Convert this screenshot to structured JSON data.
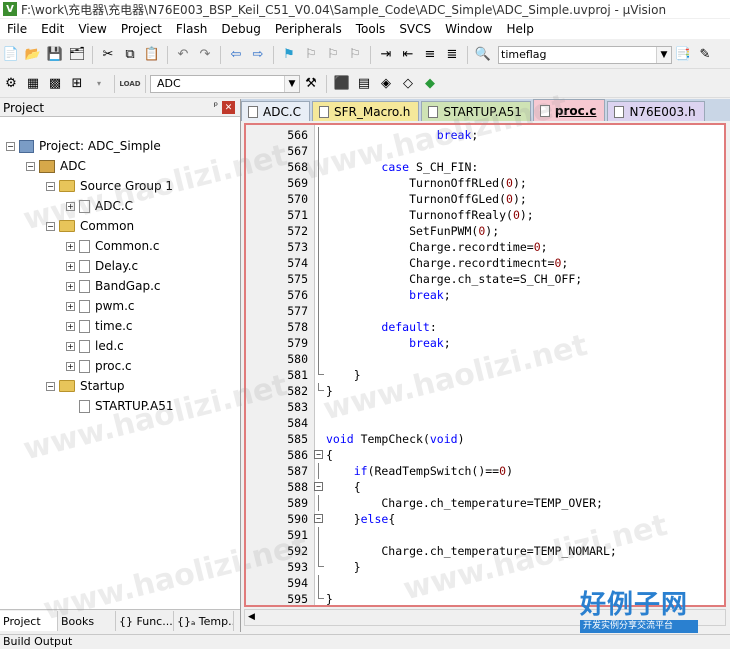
{
  "window": {
    "title": "F:\\work\\充电器\\充电器\\N76E003_BSP_Keil_C51_V0.04\\Sample_Code\\ADC_Simple\\ADC_Simple.uvproj - µVision",
    "logo_letter": "V"
  },
  "menu": [
    "File",
    "Edit",
    "View",
    "Project",
    "Flash",
    "Debug",
    "Peripherals",
    "Tools",
    "SVCS",
    "Window",
    "Help"
  ],
  "toolbar1": {
    "search_value": "timeflag"
  },
  "toolbar2": {
    "target_value": "ADC",
    "load_label": "LOAD"
  },
  "project_panel": {
    "title": "Project",
    "pin": "ᵖ",
    "close": "✕",
    "tree": [
      {
        "label": "Project: ADC_Simple",
        "level": 0,
        "icon": "project-icon",
        "expander": "−"
      },
      {
        "label": "ADC",
        "level": 1,
        "icon": "target-icon",
        "expander": "−"
      },
      {
        "label": "Source Group 1",
        "level": 2,
        "icon": "folder-icon",
        "expander": "−"
      },
      {
        "label": "ADC.C",
        "level": 3,
        "icon": "file-icon",
        "expander": "+"
      },
      {
        "label": "Common",
        "level": 2,
        "icon": "folder-icon",
        "expander": "−"
      },
      {
        "label": "Common.c",
        "level": 3,
        "icon": "file-icon",
        "expander": "+"
      },
      {
        "label": "Delay.c",
        "level": 3,
        "icon": "file-icon",
        "expander": "+"
      },
      {
        "label": "BandGap.c",
        "level": 3,
        "icon": "file-icon",
        "expander": "+"
      },
      {
        "label": "pwm.c",
        "level": 3,
        "icon": "file-icon",
        "expander": "+"
      },
      {
        "label": "time.c",
        "level": 3,
        "icon": "file-icon",
        "expander": "+"
      },
      {
        "label": "led.c",
        "level": 3,
        "icon": "file-icon",
        "expander": "+"
      },
      {
        "label": "proc.c",
        "level": 3,
        "icon": "file-icon",
        "expander": "+"
      },
      {
        "label": "Startup",
        "level": 2,
        "icon": "folder-icon",
        "expander": "−"
      },
      {
        "label": "STARTUP.A51",
        "level": 3,
        "icon": "file-icon",
        "expander": ""
      }
    ],
    "bottom_tabs": [
      "Project",
      "Books",
      "{} Func...",
      "{}ₐ Temp..."
    ]
  },
  "editor": {
    "tabs": [
      {
        "label": "ADC.C",
        "color": "#e8eef6",
        "active": false
      },
      {
        "label": "SFR_Macro.h",
        "color": "#f5e89a",
        "active": false
      },
      {
        "label": "STARTUP.A51",
        "color": "#cfe3b5",
        "active": false
      },
      {
        "label": "proc.c",
        "color": "#f6c9d2",
        "active": true
      },
      {
        "label": "N76E003.h",
        "color": "#dcd3f0",
        "active": false
      }
    ],
    "lines": [
      {
        "n": "566",
        "fold": "line",
        "code": [
          [
            "",
            "                "
          ],
          [
            "kw",
            "break"
          ],
          [
            "",
            ";"
          ]
        ]
      },
      {
        "n": "567",
        "fold": "line",
        "code": []
      },
      {
        "n": "568",
        "fold": "line",
        "code": [
          [
            "",
            "        "
          ],
          [
            "kw",
            "case"
          ],
          [
            "",
            " S_CH_FIN:"
          ]
        ]
      },
      {
        "n": "569",
        "fold": "line",
        "code": [
          [
            "",
            "            TurnonOffRLed("
          ],
          [
            "num",
            "0"
          ],
          [
            "",
            ");"
          ]
        ]
      },
      {
        "n": "570",
        "fold": "line",
        "code": [
          [
            "",
            "            TurnonOffGLed("
          ],
          [
            "num",
            "0"
          ],
          [
            "",
            ");"
          ]
        ]
      },
      {
        "n": "571",
        "fold": "line",
        "code": [
          [
            "",
            "            TurnonoffRealy("
          ],
          [
            "num",
            "0"
          ],
          [
            "",
            ");"
          ]
        ]
      },
      {
        "n": "572",
        "fold": "line",
        "code": [
          [
            "",
            "            SetFunPWM("
          ],
          [
            "num",
            "0"
          ],
          [
            "",
            ");"
          ]
        ]
      },
      {
        "n": "573",
        "fold": "line",
        "code": [
          [
            "",
            "            Charge.recordtime="
          ],
          [
            "num",
            "0"
          ],
          [
            "",
            ";"
          ]
        ]
      },
      {
        "n": "574",
        "fold": "line",
        "code": [
          [
            "",
            "            Charge.recordtimecnt="
          ],
          [
            "num",
            "0"
          ],
          [
            "",
            ";"
          ]
        ]
      },
      {
        "n": "575",
        "fold": "line",
        "code": [
          [
            "",
            "            Charge.ch_state=S_CH_OFF;"
          ]
        ]
      },
      {
        "n": "576",
        "fold": "line",
        "code": [
          [
            "",
            "            "
          ],
          [
            "kw",
            "break"
          ],
          [
            "",
            ";"
          ]
        ]
      },
      {
        "n": "577",
        "fold": "line",
        "code": []
      },
      {
        "n": "578",
        "fold": "line",
        "code": [
          [
            "",
            "        "
          ],
          [
            "kw",
            "default"
          ],
          [
            "",
            ":"
          ]
        ]
      },
      {
        "n": "579",
        "fold": "line",
        "code": [
          [
            "",
            "            "
          ],
          [
            "kw",
            "break"
          ],
          [
            "",
            ";"
          ]
        ]
      },
      {
        "n": "580",
        "fold": "line",
        "code": []
      },
      {
        "n": "581",
        "fold": "end",
        "code": [
          [
            "",
            "    }"
          ]
        ]
      },
      {
        "n": "582",
        "fold": "end",
        "code": [
          [
            "",
            "}"
          ]
        ]
      },
      {
        "n": "583",
        "fold": "none",
        "code": []
      },
      {
        "n": "584",
        "fold": "none",
        "code": []
      },
      {
        "n": "585",
        "fold": "none",
        "code": [
          [
            "kw",
            "void"
          ],
          [
            "",
            " TempCheck("
          ],
          [
            "kw",
            "void"
          ],
          [
            "",
            ")"
          ]
        ]
      },
      {
        "n": "586",
        "fold": "box",
        "code": [
          [
            "",
            "{"
          ]
        ]
      },
      {
        "n": "587",
        "fold": "line",
        "code": [
          [
            "",
            "    "
          ],
          [
            "kw",
            "if"
          ],
          [
            "",
            "(ReadTempSwitch()=="
          ],
          [
            "num",
            "0"
          ],
          [
            "",
            ")"
          ]
        ]
      },
      {
        "n": "588",
        "fold": "box",
        "code": [
          [
            "",
            "    {"
          ]
        ]
      },
      {
        "n": "589",
        "fold": "line",
        "code": [
          [
            "",
            "        Charge.ch_temperature=TEMP_OVER;"
          ]
        ]
      },
      {
        "n": "590",
        "fold": "box",
        "code": [
          [
            "",
            "    }"
          ],
          [
            "kw",
            "else"
          ],
          [
            "",
            "{"
          ]
        ]
      },
      {
        "n": "591",
        "fold": "line",
        "code": []
      },
      {
        "n": "592",
        "fold": "line",
        "code": [
          [
            "",
            "        Charge.ch_temperature=TEMP_NOMARL;"
          ]
        ]
      },
      {
        "n": "593",
        "fold": "end",
        "code": [
          [
            "",
            "    }"
          ]
        ]
      },
      {
        "n": "594",
        "fold": "line",
        "code": []
      },
      {
        "n": "595",
        "fold": "end",
        "code": [
          [
            "",
            "}"
          ]
        ]
      }
    ]
  },
  "status": {
    "build_output": "Build Output"
  },
  "watermark": {
    "text": "www.haolizi.net"
  },
  "logo": {
    "main": "好例子网",
    "sub": "开发实例分享交流平台"
  }
}
